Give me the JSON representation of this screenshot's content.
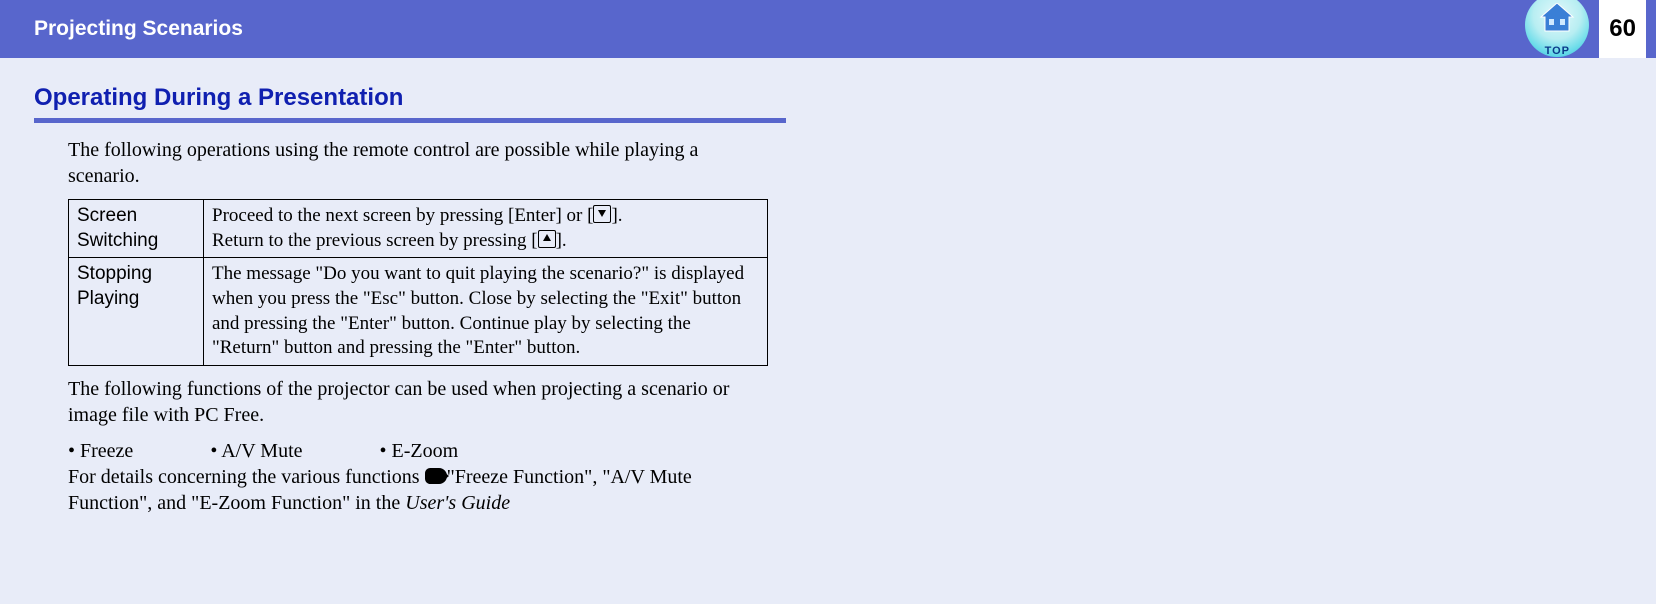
{
  "header": {
    "title": "Projecting Scenarios",
    "top_label": "TOP",
    "page_number": "60"
  },
  "section": {
    "title": "Operating During a Presentation",
    "intro": "The following operations using the remote control are possible while playing a scenario.",
    "table": {
      "rows": [
        {
          "label": "Screen Switching",
          "desc_line1_pre": "Proceed to the next screen by pressing [Enter] or [",
          "desc_line1_post": "].",
          "desc_line2_pre": "Return to the previous screen by pressing [",
          "desc_line2_post": "]."
        },
        {
          "label": "Stopping Playing",
          "desc": "The message \"Do you want to quit playing the scenario?\" is displayed when you press the \"Esc\" button. Close by selecting the \"Exit\" button and pressing the \"Enter\" button. Continue play by selecting the \"Return\" button and pressing the \"Enter\" button."
        }
      ]
    },
    "after_table": "The following functions of the projector can be used when projecting a scenario or image file with PC Free.",
    "bullets": [
      "Freeze",
      "A/V Mute",
      "E-Zoom"
    ],
    "details_pre": "For details concerning the various functions ",
    "details_ref": "\"Freeze Function\", \"A/V Mute Function\", and \"E-Zoom Function\" in the ",
    "details_guide": "User's Guide"
  }
}
